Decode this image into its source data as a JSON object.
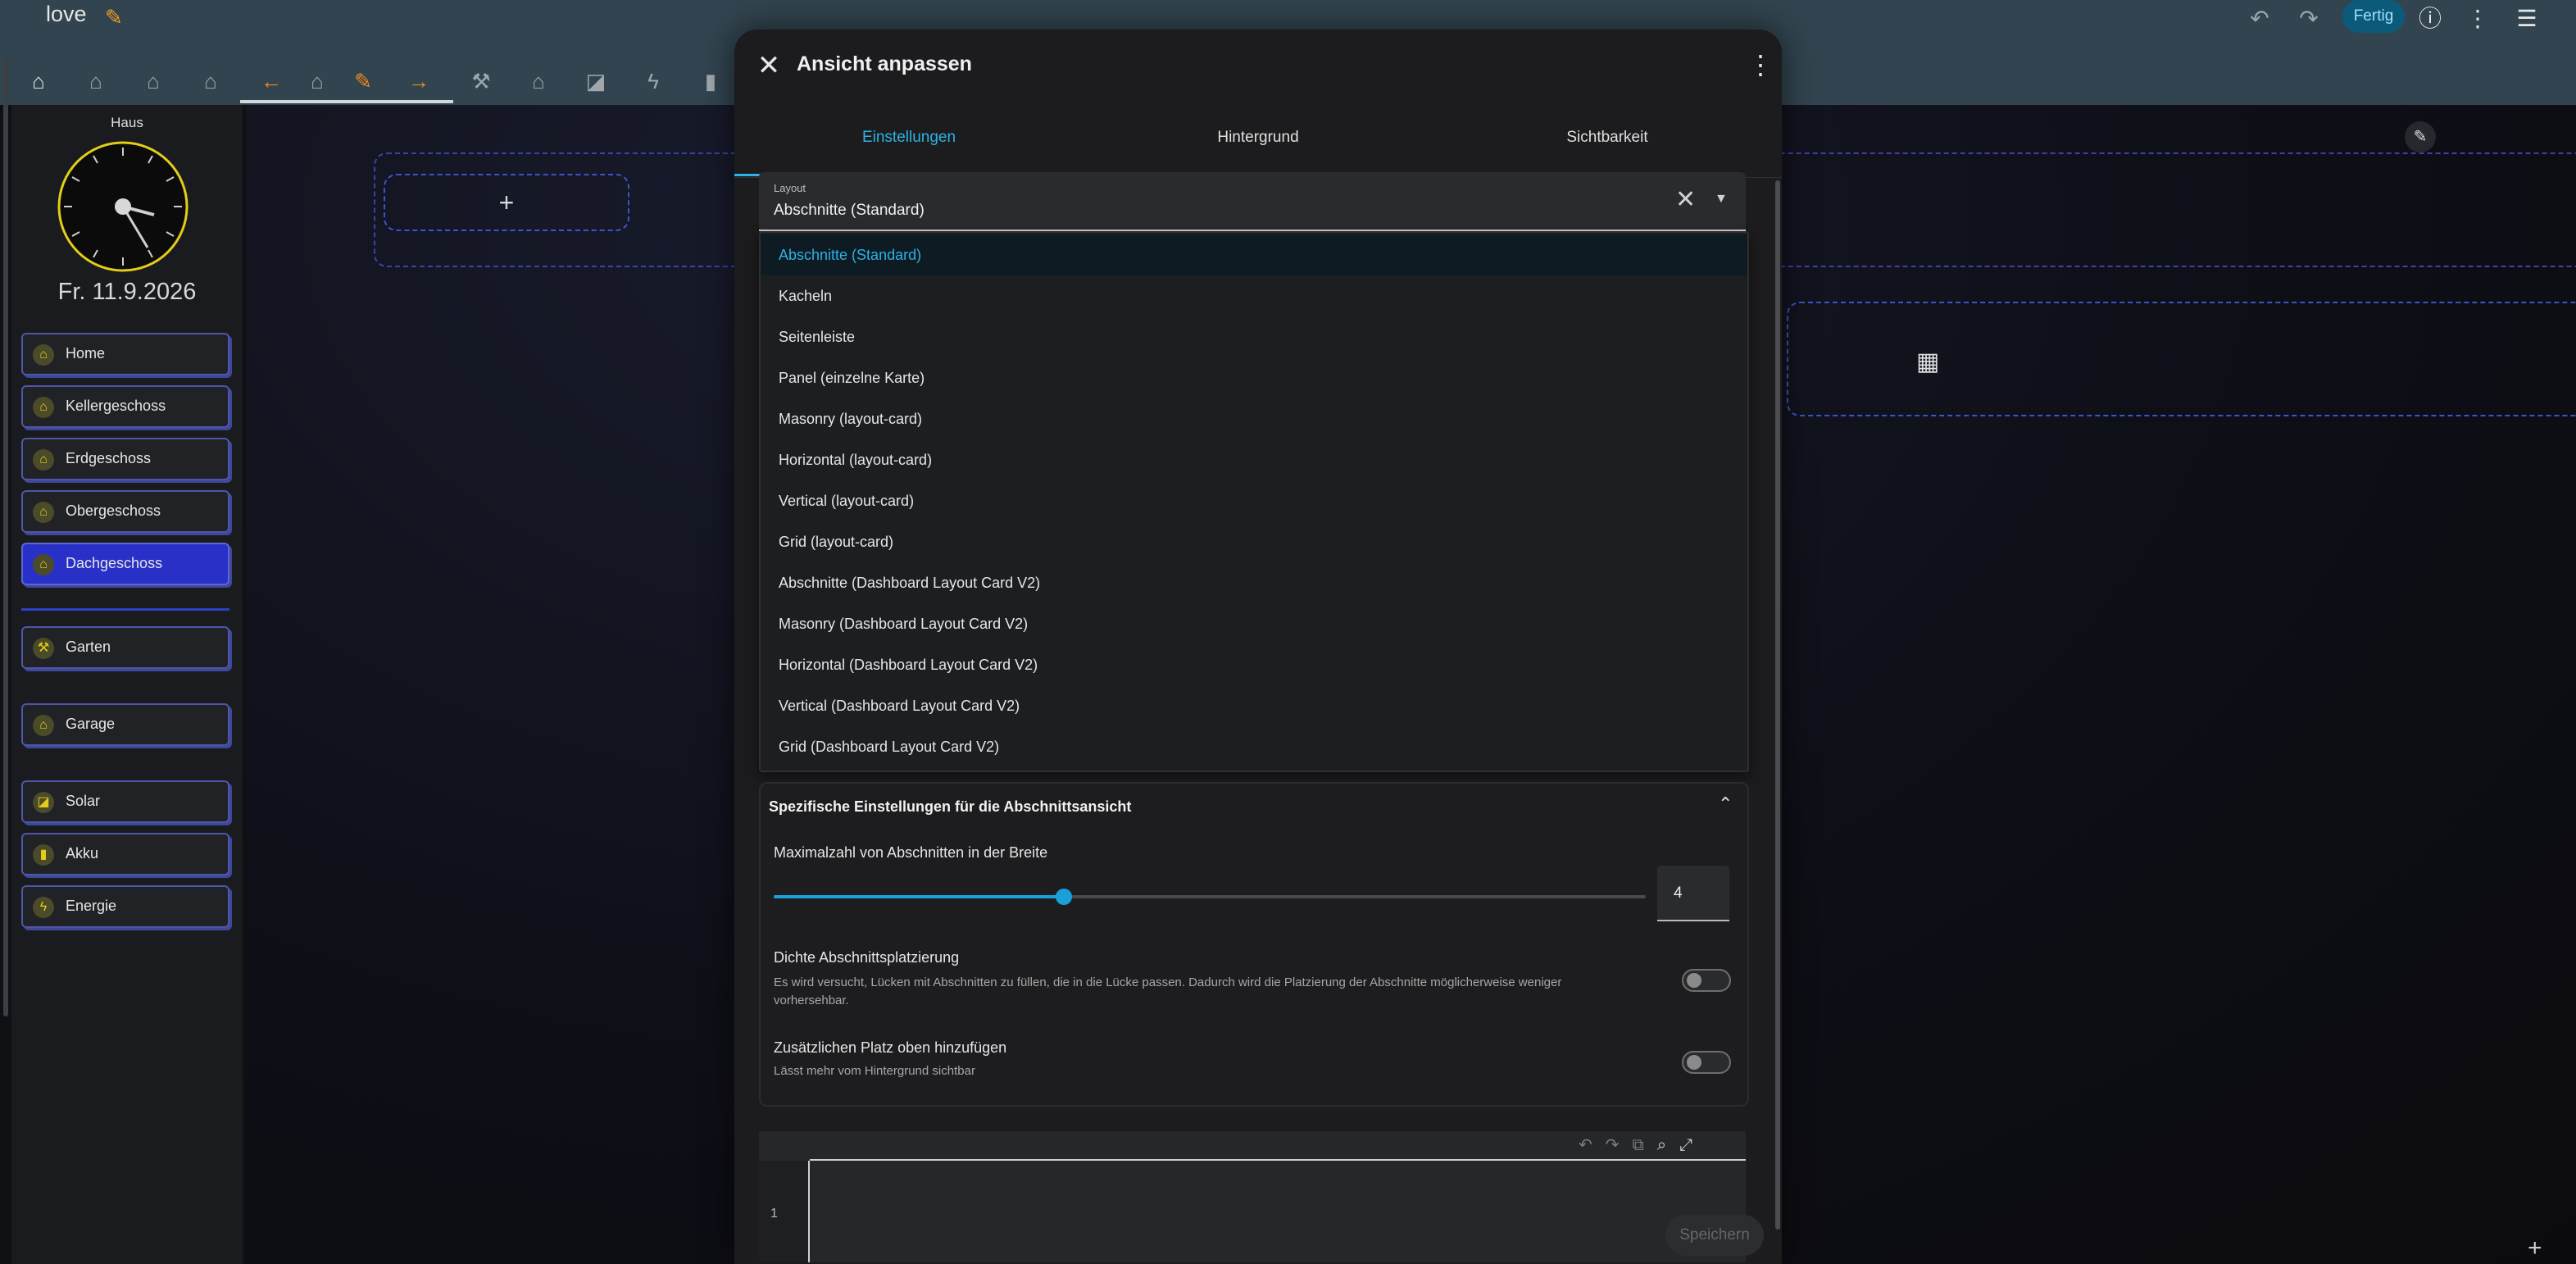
{
  "header": {
    "title": "love",
    "done_label": "Fertig",
    "icons": [
      "pencil-icon",
      "undo-icon",
      "redo-icon",
      "help-icon",
      "more-icon",
      "edit-list-icon"
    ]
  },
  "view_tabs": [
    "home-icon",
    "home-outline-icon",
    "home-outline-icon",
    "home-outline-icon",
    "arrow-left-icon",
    "home-outline-icon",
    "pencil-icon",
    "arrow-right-icon",
    "shovel-icon",
    "garage-icon",
    "solar-icon",
    "lightning-icon",
    "battery-icon"
  ],
  "sidebar": {
    "caption": "Haus",
    "date": "Fr. 11.9.2026",
    "items": [
      {
        "label": "Home"
      },
      {
        "label": "Kellergeschoss"
      },
      {
        "label": "Erdgeschoss"
      },
      {
        "label": "Obergeschoss"
      },
      {
        "label": "Dachgeschoss"
      },
      {
        "label": "Garten"
      },
      {
        "label": "Garage"
      },
      {
        "label": "Solar"
      },
      {
        "label": "Akku"
      },
      {
        "label": "Energie"
      }
    ]
  },
  "main": {
    "add_label": "+"
  },
  "dialog": {
    "title": "Ansicht anpassen",
    "tabs": [
      "Einstellungen",
      "Hintergrund",
      "Sichtbarkeit"
    ],
    "layout_label": "Layout",
    "layout_value": "Abschnitte (Standard)",
    "options": [
      "Abschnitte (Standard)",
      "Kacheln",
      "Seitenleiste",
      "Panel (einzelne Karte)",
      "Masonry (layout-card)",
      "Horizontal (layout-card)",
      "Vertical (layout-card)",
      "Grid (layout-card)",
      "Abschnitte (Dashboard Layout Card V2)",
      "Masonry (Dashboard Layout Card V2)",
      "Horizontal (Dashboard Layout Card V2)",
      "Vertical (Dashboard Layout Card V2)",
      "Grid (Dashboard Layout Card V2)"
    ],
    "section_title": "Spezifische Einstellungen für die Abschnittsansicht",
    "slider_label": "Maximalzahl von Abschnitten in der Breite",
    "slider_value": "4",
    "slider_fraction": 0.333,
    "dense_title": "Dichte Abschnittsplatzierung",
    "dense_desc": "Es wird versucht, Lücken mit Abschnitten zu füllen, die in die Lücke passen. Dadurch wird die Platzierung der Abschnitte möglicherweise weniger vorhersehbar.",
    "dense_on": false,
    "top_title": "Zusätzlichen Platz oben hinzufügen",
    "top_desc": "Lässt mehr vom Hintergrund sichtbar",
    "top_on": false,
    "editor_line": "1",
    "save_label": "Speichern"
  },
  "colors": {
    "accent": "#2bb2e6",
    "header": "#31444f",
    "active_nav": "#2930c8",
    "icon_yellow": "#e3cd19",
    "orange": "#f08a1c"
  }
}
